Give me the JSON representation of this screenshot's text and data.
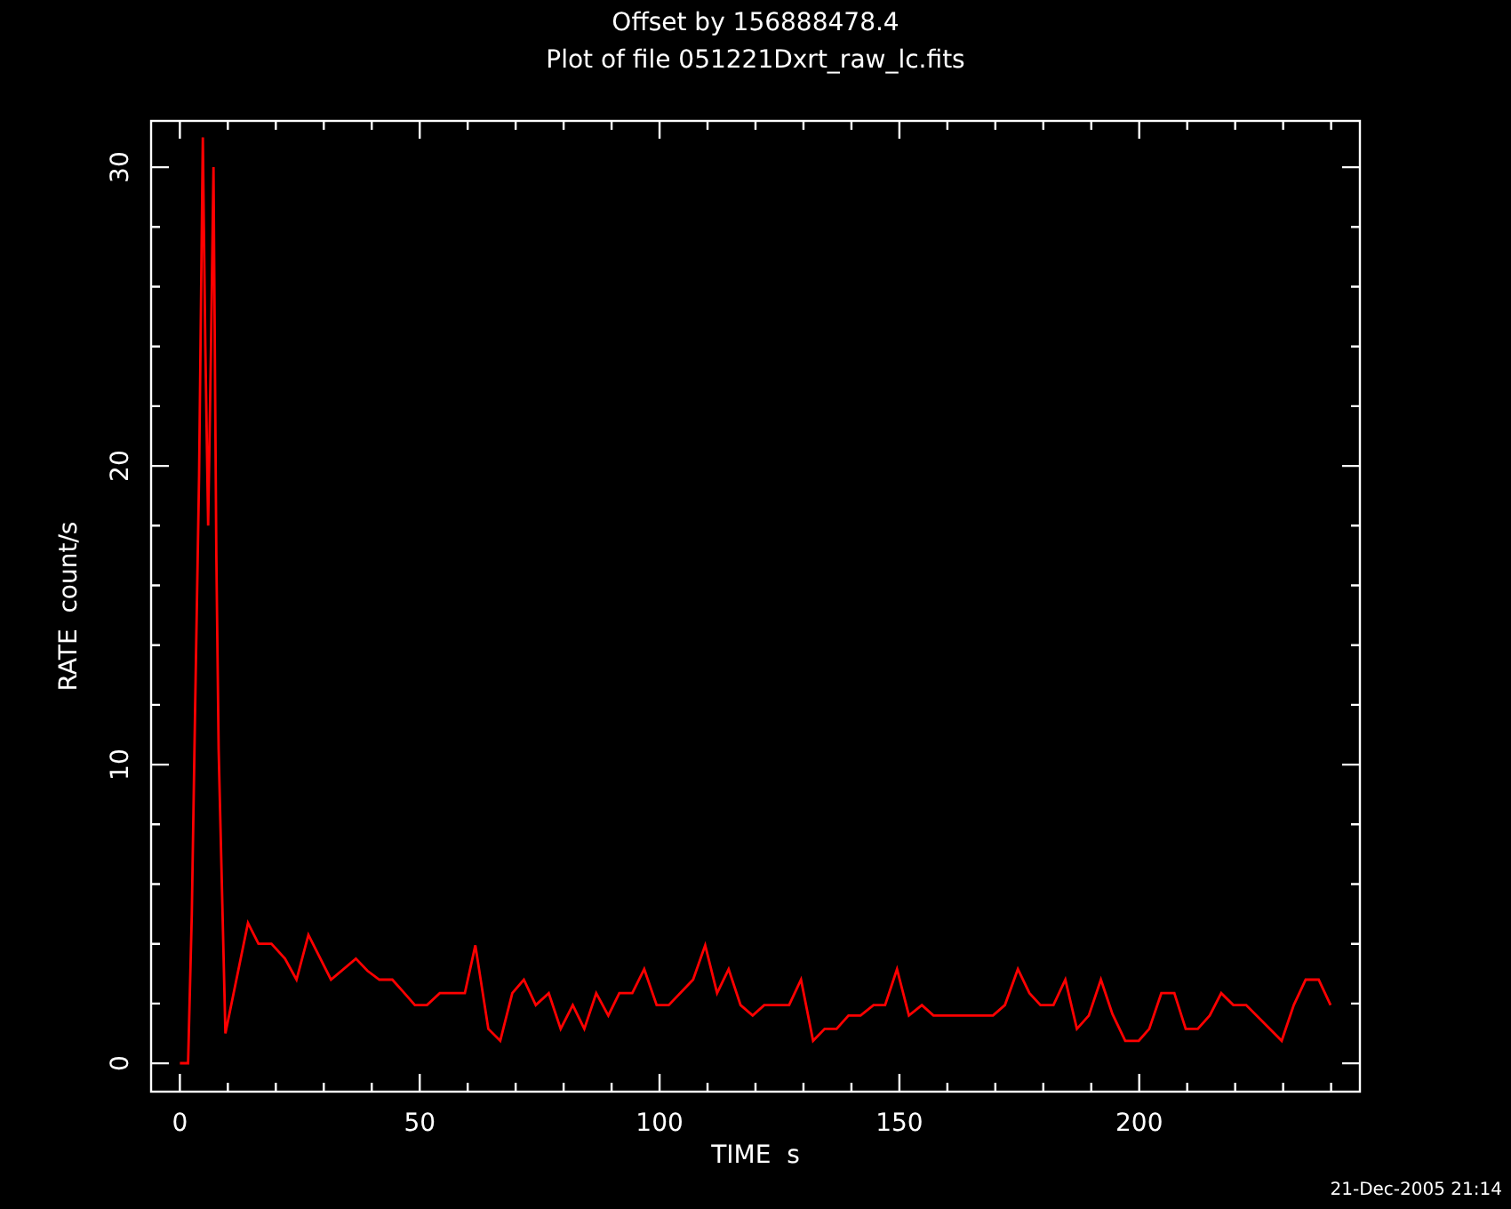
{
  "offset_note": "Offset by 156888478.4",
  "chart_data": {
    "type": "line",
    "title": "Plot of file 051221Dxrt_raw_lc.fits",
    "xlabel": "TIME  s",
    "ylabel": "RATE  count/s",
    "xlim": [
      -6,
      246
    ],
    "ylim": [
      -0.95,
      31.55
    ],
    "xticks": [
      0,
      50,
      100,
      150,
      200
    ],
    "yticks": [
      0,
      10,
      20,
      30
    ],
    "x": [
      0,
      1.7,
      2.5,
      3.2,
      4,
      4.8,
      5.3,
      5.9,
      6.5,
      7,
      7.6,
      8.1,
      9.5,
      14.2,
      16.4,
      19.1,
      21.9,
      24.3,
      26.8,
      31.5,
      36.7,
      39.1,
      41.6,
      44.3,
      46.5,
      49,
      51.5,
      54.2,
      59.4,
      61.6,
      64.3,
      66.8,
      69.3,
      71.7,
      74.2,
      76.9,
      79.4,
      81.9,
      84.3,
      86.8,
      89.3,
      91.6,
      94.3,
      96.8,
      99.4,
      101.9,
      104.3,
      107,
      109.5,
      112,
      114.4,
      116.9,
      119.4,
      121.8,
      127,
      129.5,
      132,
      134.4,
      136.9,
      139.4,
      141.9,
      144.6,
      147,
      149.5,
      152,
      154.7,
      157.1,
      169.5,
      172,
      174.7,
      177.1,
      179.4,
      182.1,
      184.6,
      187,
      189.5,
      192,
      194.4,
      197.1,
      199.9,
      202.1,
      204.6,
      207.3,
      209.7,
      212.2,
      214.7,
      217.1,
      219.6,
      222.3,
      229.7,
      232.2,
      234.7,
      237.4,
      239.9
    ],
    "series": [
      {
        "color": "#ff0000",
        "values": [
          0,
          0,
          5,
          12,
          19.7,
          31,
          24,
          18,
          24,
          30,
          17,
          10.5,
          1,
          4.7,
          4,
          4,
          3.5,
          2.8,
          4.3,
          2.8,
          3.5,
          3.1,
          2.8,
          2.8,
          2.4,
          1.95,
          1.95,
          2.35,
          2.35,
          3.95,
          1.15,
          0.75,
          2.35,
          2.8,
          1.95,
          2.35,
          1.15,
          1.95,
          1.15,
          2.35,
          1.6,
          2.35,
          2.35,
          3.15,
          1.95,
          1.95,
          2.35,
          2.8,
          3.95,
          2.35,
          3.15,
          1.95,
          1.6,
          1.95,
          1.95,
          2.8,
          0.75,
          1.15,
          1.15,
          1.6,
          1.6,
          1.95,
          1.95,
          3.15,
          1.6,
          1.95,
          1.6,
          1.6,
          1.95,
          3.15,
          2.35,
          1.95,
          1.95,
          2.8,
          1.15,
          1.6,
          2.8,
          1.65,
          0.75,
          0.75,
          1.15,
          2.35,
          2.35,
          1.15,
          1.15,
          1.6,
          2.35,
          1.95,
          1.95,
          0.75,
          1.95,
          2.8,
          2.8,
          1.95
        ]
      }
    ]
  },
  "date_stamp": "21-Dec-2005 21:14"
}
